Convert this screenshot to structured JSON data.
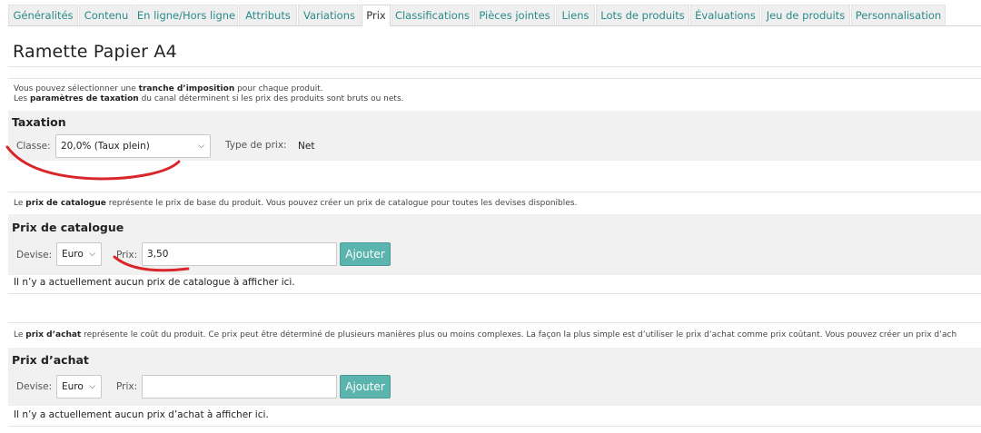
{
  "tabs": [
    {
      "label": "Généralités",
      "active": false
    },
    {
      "label": "Contenu",
      "active": false
    },
    {
      "label": "En ligne/Hors ligne",
      "active": false
    },
    {
      "label": "Attributs",
      "active": false
    },
    {
      "label": "Variations",
      "active": false
    },
    {
      "label": "Prix",
      "active": true
    },
    {
      "label": "Classifications",
      "active": false
    },
    {
      "label": "Pièces jointes",
      "active": false
    },
    {
      "label": "Liens",
      "active": false
    },
    {
      "label": "Lots de produits",
      "active": false
    },
    {
      "label": "Évaluations",
      "active": false
    },
    {
      "label": "Jeu de produits",
      "active": false
    },
    {
      "label": "Personnalisation",
      "active": false
    }
  ],
  "page_title": "Ramette Papier A4",
  "taxation": {
    "note_1_prefix": "Vous pouvez sélectionner une ",
    "note_1_bold": "tranche d’imposition",
    "note_1_suffix": " pour chaque produit.",
    "note_2_prefix": "Les ",
    "note_2_bold": "paramètres de taxation",
    "note_2_suffix": " du canal déterminent si les prix des produits sont bruts ou nets.",
    "title": "Taxation",
    "class_label": "Classe:",
    "class_value": "20,0% (Taux plein)",
    "price_type_label": "Type de prix:",
    "price_type_value": "Net"
  },
  "catalog": {
    "note_prefix": "Le ",
    "note_bold": "prix de catalogue",
    "note_suffix": " représente le prix de base du produit. Vous pouvez créer un prix de catalogue pour toutes les devises disponibles.",
    "title": "Prix de catalogue",
    "currency_label": "Devise:",
    "currency_value": "Euro",
    "price_label": "Prix:",
    "price_value": "3,50",
    "add_button": "Ajouter",
    "empty_text": "Il n’y a actuellement aucun prix de catalogue à afficher ici."
  },
  "purchase": {
    "note_prefix": "Le ",
    "note_bold": "prix d’achat",
    "note_suffix": " représente le coût du produit. Ce prix peut être déterminé de plusieurs manières plus ou moins complexes. La façon la plus simple est d’utiliser le prix d’achat comme prix coûtant. Vous pouvez créer un prix d’ach",
    "title": "Prix d’achat",
    "currency_label": "Devise:",
    "currency_value": "Euro",
    "price_label": "Prix:",
    "price_value": "",
    "add_button": "Ajouter",
    "empty_text": "Il n’y a actuellement aucun prix d’achat à afficher ici."
  },
  "colors": {
    "accent": "#5bb5ae",
    "tab_text": "#2a8a8a",
    "annotation_red": "#d9262a"
  }
}
